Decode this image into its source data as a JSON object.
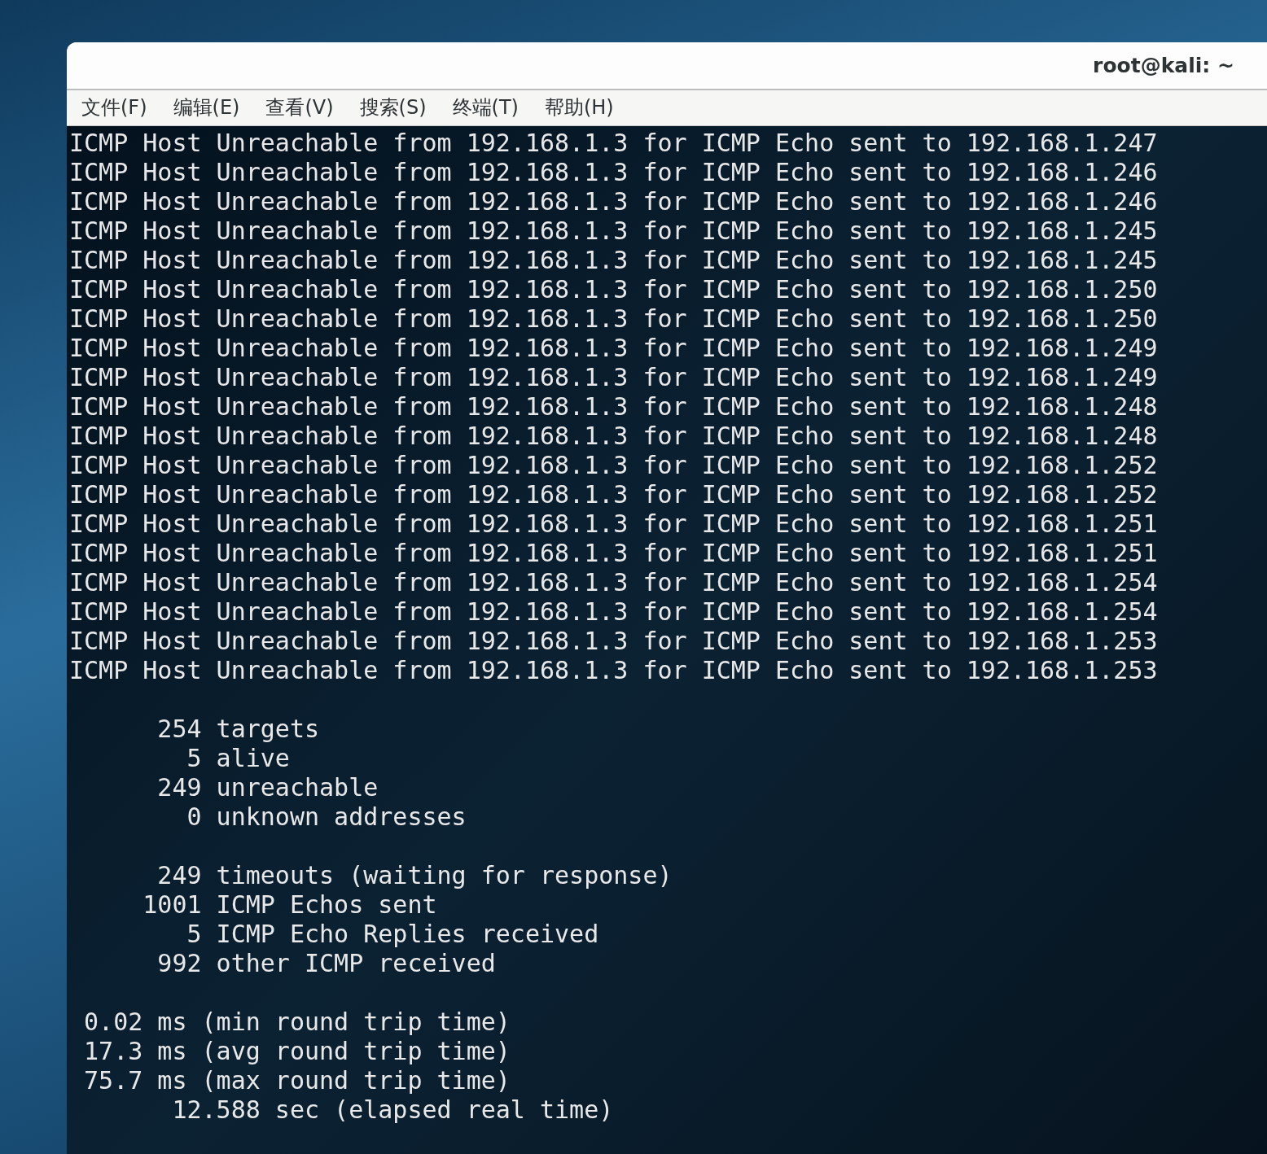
{
  "window": {
    "title": "root@kali: ~"
  },
  "menu": [
    "文件(F)",
    "编辑(E)",
    "查看(V)",
    "搜索(S)",
    "终端(T)",
    "帮助(H)"
  ],
  "terminal": {
    "blocks": [
      [
        "ICMP Host Unreachable from 192.168.1.3 for ICMP Echo sent to 192.168.1.247",
        "ICMP Host Unreachable from 192.168.1.3 for ICMP Echo sent to 192.168.1.246",
        "ICMP Host Unreachable from 192.168.1.3 for ICMP Echo sent to 192.168.1.246",
        "ICMP Host Unreachable from 192.168.1.3 for ICMP Echo sent to 192.168.1.245",
        "ICMP Host Unreachable from 192.168.1.3 for ICMP Echo sent to 192.168.1.245",
        "ICMP Host Unreachable from 192.168.1.3 for ICMP Echo sent to 192.168.1.250",
        "ICMP Host Unreachable from 192.168.1.3 for ICMP Echo sent to 192.168.1.250",
        "ICMP Host Unreachable from 192.168.1.3 for ICMP Echo sent to 192.168.1.249",
        "ICMP Host Unreachable from 192.168.1.3 for ICMP Echo sent to 192.168.1.249",
        "ICMP Host Unreachable from 192.168.1.3 for ICMP Echo sent to 192.168.1.248",
        "ICMP Host Unreachable from 192.168.1.3 for ICMP Echo sent to 192.168.1.248",
        "ICMP Host Unreachable from 192.168.1.3 for ICMP Echo sent to 192.168.1.252",
        "ICMP Host Unreachable from 192.168.1.3 for ICMP Echo sent to 192.168.1.252",
        "ICMP Host Unreachable from 192.168.1.3 for ICMP Echo sent to 192.168.1.251",
        "ICMP Host Unreachable from 192.168.1.3 for ICMP Echo sent to 192.168.1.251",
        "ICMP Host Unreachable from 192.168.1.3 for ICMP Echo sent to 192.168.1.254",
        "ICMP Host Unreachable from 192.168.1.3 for ICMP Echo sent to 192.168.1.254",
        "ICMP Host Unreachable from 192.168.1.3 for ICMP Echo sent to 192.168.1.253",
        "ICMP Host Unreachable from 192.168.1.3 for ICMP Echo sent to 192.168.1.253"
      ],
      [
        "      254 targets",
        "        5 alive",
        "      249 unreachable",
        "        0 unknown addresses"
      ],
      [
        "      249 timeouts (waiting for response)",
        "     1001 ICMP Echos sent",
        "        5 ICMP Echo Replies received",
        "      992 other ICMP received"
      ],
      [
        " 0.02 ms (min round trip time)",
        " 17.3 ms (avg round trip time)",
        " 75.7 ms (max round trip time)",
        "       12.588 sec (elapsed real time)"
      ]
    ]
  }
}
